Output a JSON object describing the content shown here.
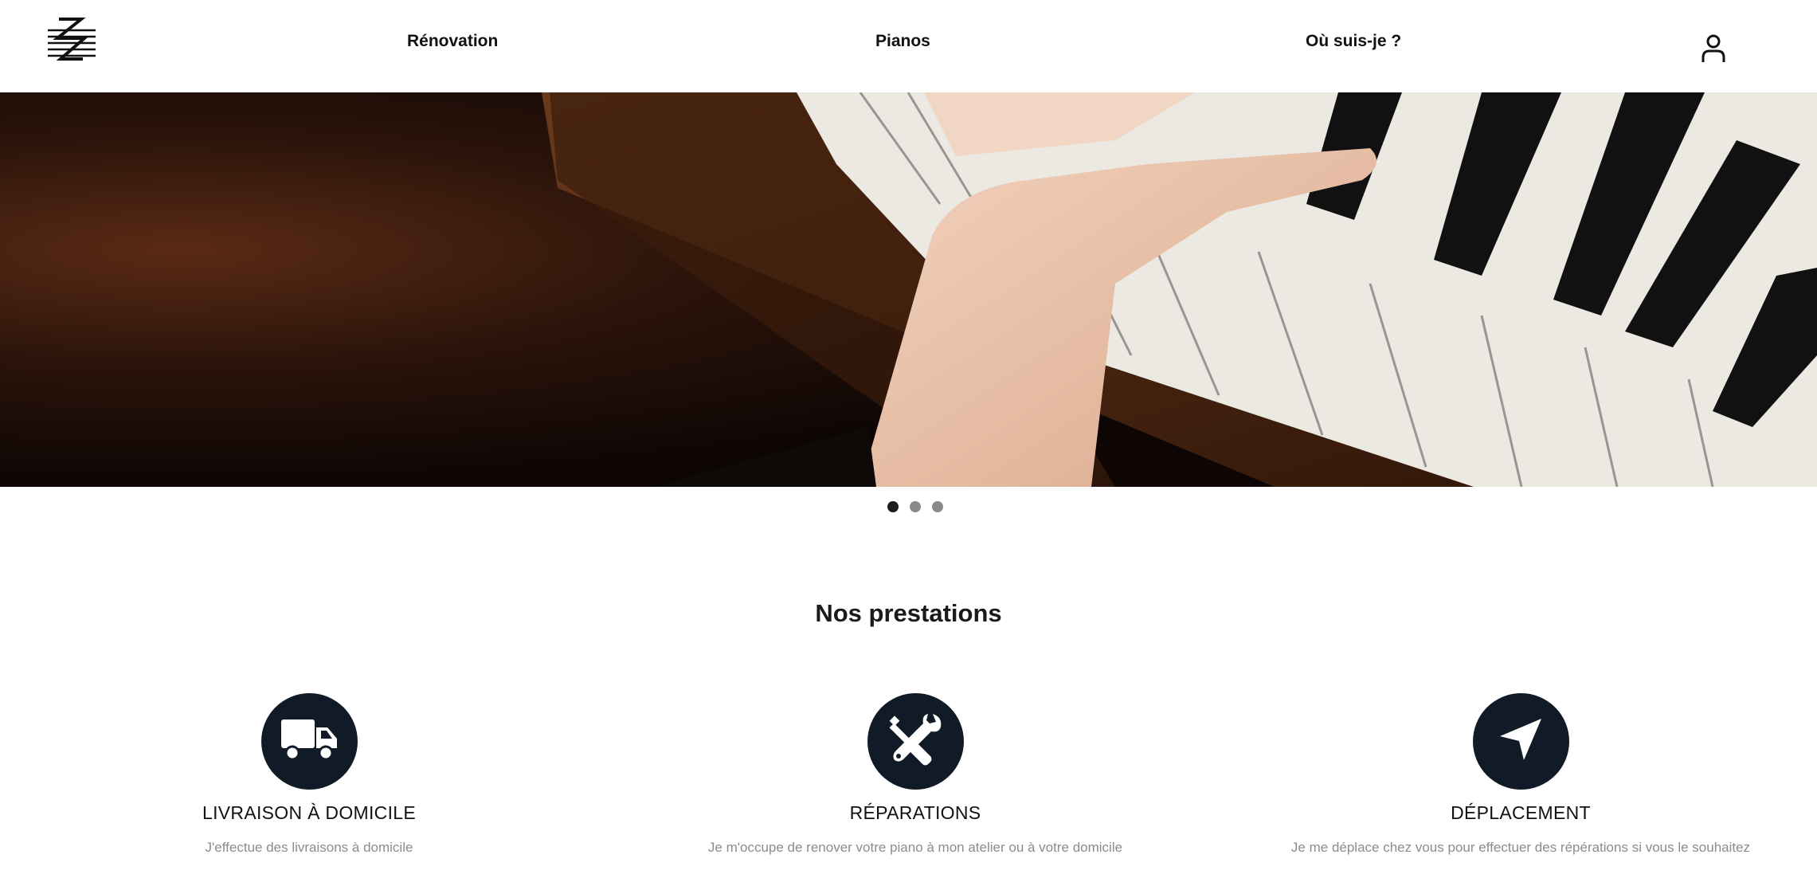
{
  "nav": {
    "items": [
      {
        "label": "Rénovation"
      },
      {
        "label": "Pianos"
      },
      {
        "label": "Où suis-je ?"
      }
    ]
  },
  "carousel": {
    "slide_count": 3,
    "active_index": 0
  },
  "services": {
    "title": "Nos prestations",
    "items": [
      {
        "icon": "truck-icon",
        "title": "LIVRAISON À DOMICILE",
        "description": "J'effectue des livraisons à domicile"
      },
      {
        "icon": "wrench-screwdriver-icon",
        "title": "RÉPARATIONS",
        "description": "Je m'occupe de renover votre piano à mon atelier ou à votre domicile"
      },
      {
        "icon": "navigation-arrow-icon",
        "title": "DÉPLACEMENT",
        "description": "Je me déplace chez vous pour effectuer des répérations si vous le souhaitez"
      }
    ]
  },
  "colors": {
    "icon_circle": "#111b28",
    "active_dot": "#1c1c1c",
    "inactive_dot": "#8a8a8a",
    "description_text": "#8c8c8c"
  }
}
